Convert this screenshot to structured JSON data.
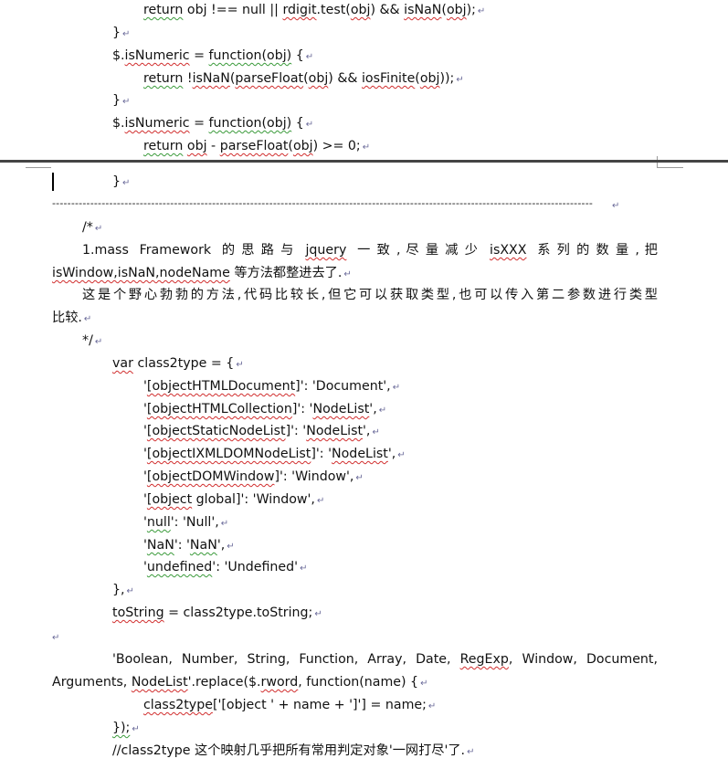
{
  "lines_top": [
    {
      "text": "return obj !== null || rdigit.test(obj) && isNaN(obj);"
    },
    {
      "text": "}"
    },
    {
      "text": "$.isNumeric = function(obj) {"
    },
    {
      "text": "return !isNaN(parseFloat(obj) && iosFinite(obj));"
    },
    {
      "text": "}"
    },
    {
      "text": "$.isNumeric = function(obj) {"
    },
    {
      "text": "return obj - parseFloat(obj) >= 0;"
    }
  ],
  "after_break": {
    "brace": "}",
    "separator": "----------------------------------------------------------------------------------------------------------------------------------------------",
    "comment_open": "/*",
    "para1_a": "1.mass  Framework  的思路与  jquery  一致，尽量减少  isXXX  系列的数量，把",
    "para1_b": "isWindow,isNaN,nodeName 等方法都整进去了.",
    "para2_a": "这是个野心勃勃的方法,代码比较长,但它可以获取类型,也可以传入第二参数进行类型",
    "para2_b": "比较.",
    "comment_close": "*/"
  },
  "code": {
    "var_line": "var class2type = {",
    "entries": [
      "'[objectHTMLDocument]': 'Document',",
      "'[objectHTMLCollection]': 'NodeList',",
      "'[objectStaticNodeList]': 'NodeList',",
      "'[objectIXMLDOMNodeList]': 'NodeList',",
      "'[objectDOMWindow]': 'Window',",
      "'[object global]': 'Window',",
      "'null': 'Null',",
      "'NaN': 'NaN',",
      "'undefined': 'Undefined'"
    ],
    "close": "},",
    "tostring": "toString = class2type.toString;",
    "replace_a": "'Boolean,  Number,  String,  Function,  Array,  Date,  RegExp,  Window,  Document,",
    "replace_b": "Arguments, NodeList'.replace($.rword, function(name) {",
    "assign": "class2type['[object ' + name + ']'] = name;",
    "end": "});",
    "last_comment": "//class2type 这个映射几乎把所有常用判定对象'一网打尽'了."
  },
  "marks": {
    "para": "↵"
  }
}
